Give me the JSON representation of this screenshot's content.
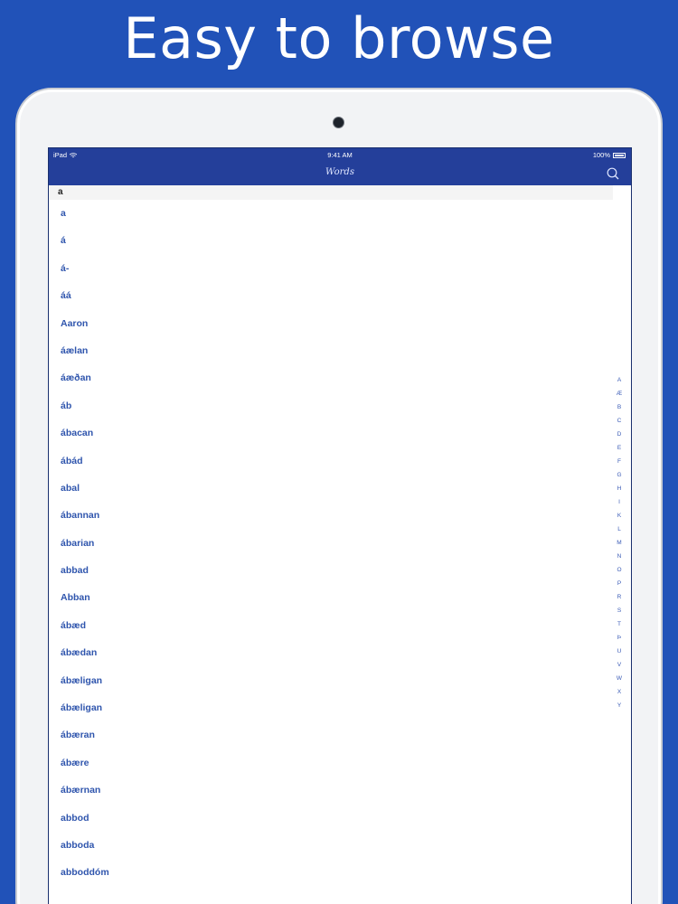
{
  "headline": "Easy to browse",
  "status_bar": {
    "device": "iPad",
    "time": "9:41 AM",
    "battery": "100%"
  },
  "nav": {
    "title": "Words",
    "search_icon": "search-icon"
  },
  "section_header": "a",
  "words": [
    "a",
    "á",
    "á-",
    "áá",
    "Aaron",
    "áælan",
    "áæðan",
    "áb",
    "ábacan",
    "ábád",
    "abal",
    "ábannan",
    "ábarian",
    "abbad",
    "Abban",
    "ábæd",
    "ábædan",
    "ábæligan",
    "ábæligan",
    "ábæran",
    "ábære",
    "ábærnan",
    "abbod",
    "abboda",
    "abboddóm"
  ],
  "index_letters": [
    "A",
    "Æ",
    "B",
    "C",
    "D",
    "E",
    "F",
    "G",
    "H",
    "I",
    "K",
    "L",
    "M",
    "N",
    "O",
    "P",
    "R",
    "S",
    "T",
    "Þ",
    "U",
    "V",
    "W",
    "X",
    "Y"
  ],
  "colors": {
    "background": "#2152b8",
    "nav": "#243f9a",
    "word_link": "#2f55ad"
  },
  "tab_icons": [
    "book-icon",
    "list-icon",
    "up-arrow-icon",
    "puzzle-icon",
    "gear-icon"
  ]
}
